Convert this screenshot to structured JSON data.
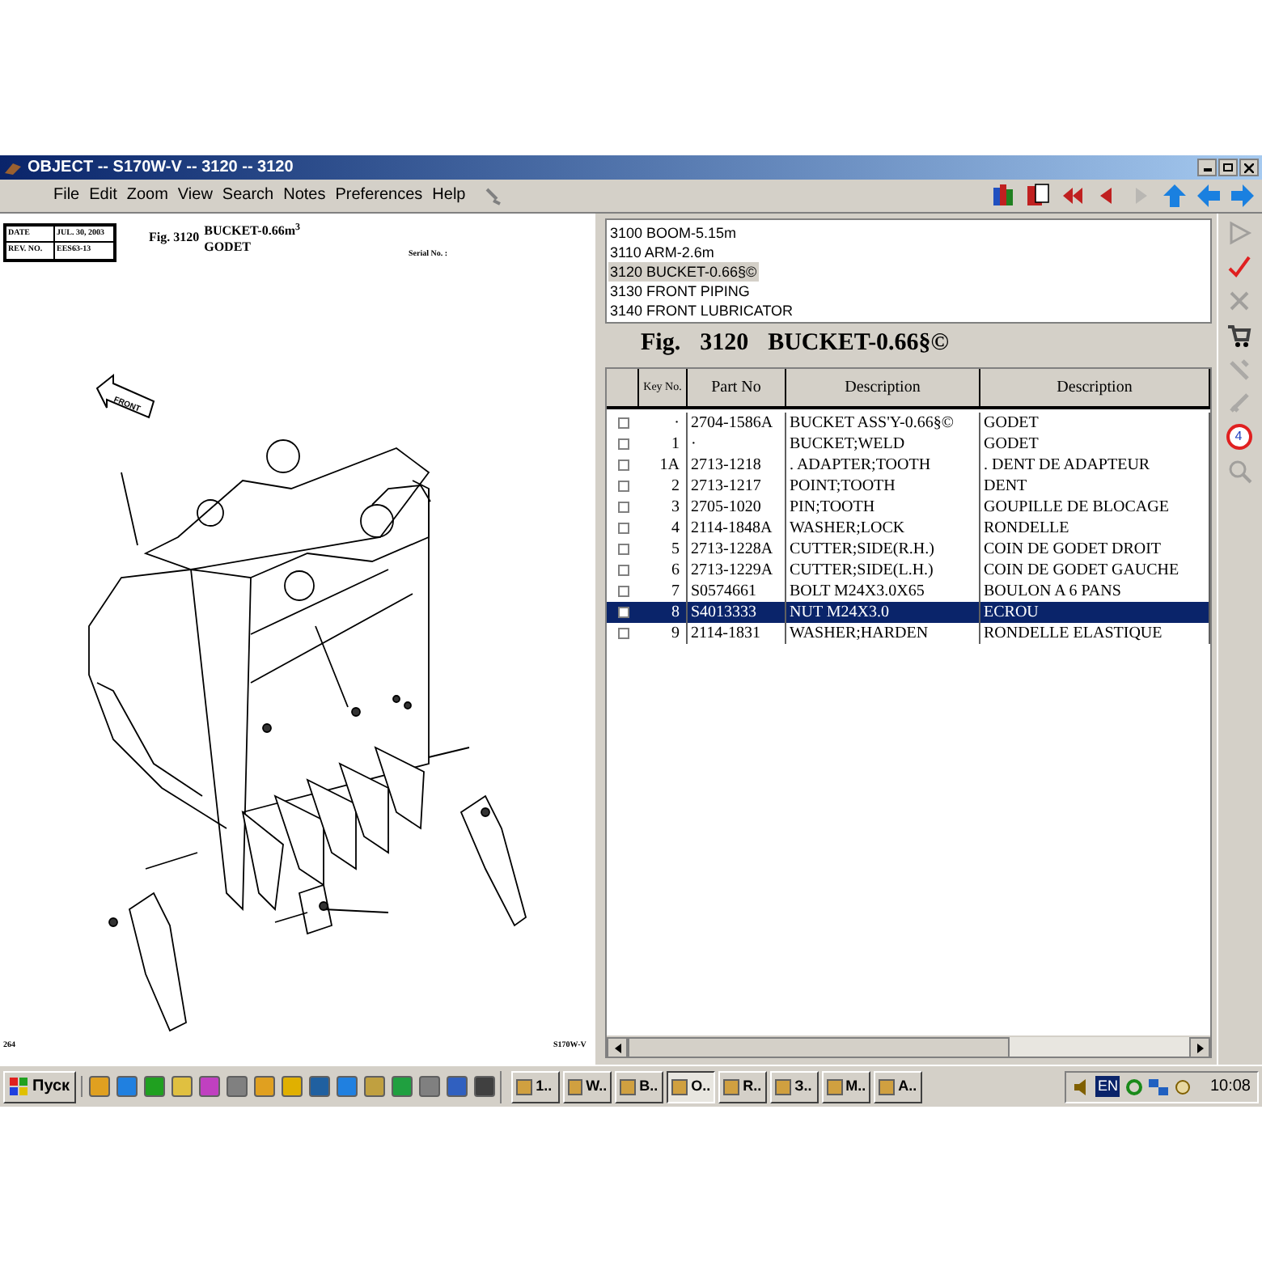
{
  "window": {
    "title": "OBJECT -- S170W-V -- 3120 -- 3120"
  },
  "menu": [
    "File",
    "Edit",
    "Zoom",
    "View",
    "Search",
    "Notes",
    "Preferences",
    "Help"
  ],
  "toolbar": [
    {
      "kind": "books",
      "disabled": false
    },
    {
      "kind": "book-red",
      "disabled": false
    },
    {
      "kind": "first",
      "disabled": false
    },
    {
      "kind": "prev",
      "disabled": false
    },
    {
      "kind": "next",
      "disabled": true
    },
    {
      "kind": "up",
      "disabled": false
    },
    {
      "kind": "back",
      "disabled": false
    },
    {
      "kind": "forward",
      "disabled": false
    }
  ],
  "drawing": {
    "date_label": "DATE",
    "date": "JUL. 30, 2003",
    "rev_label": "REV. NO.",
    "rev": "EES63-13",
    "fig": "Fig. 3120",
    "title": "BUCKET-0.66m$^{3}$",
    "subtitle": "GODET",
    "serial": "Serial No. :",
    "arrow_label": "FRONT",
    "page": "264",
    "model": "S170W-V"
  },
  "sections": [
    {
      "label": "3100 BOOM-5.15m",
      "selected": false
    },
    {
      "label": "3110 ARM-2.6m",
      "selected": false
    },
    {
      "label": "3120 BUCKET-0.66§©",
      "selected": true
    },
    {
      "label": "3130 FRONT PIPING",
      "selected": false
    },
    {
      "label": "3140 FRONT LUBRICATOR",
      "selected": false
    }
  ],
  "figure_title": {
    "fig": "Fig.",
    "number": "3120",
    "name": "BUCKET-0.66§©"
  },
  "table": {
    "columns": [
      "Key No.",
      "Part No",
      "Description",
      "Description"
    ],
    "rows": [
      {
        "checked": false,
        "selected": false,
        "cells": [
          "·",
          "2704-1586A",
          "BUCKET ASS'Y-0.66§©",
          "GODET"
        ]
      },
      {
        "checked": false,
        "selected": false,
        "cells": [
          "1",
          "·",
          "BUCKET;WELD",
          "GODET"
        ]
      },
      {
        "checked": false,
        "selected": false,
        "cells": [
          "1A",
          "2713-1218",
          ". ADAPTER;TOOTH",
          ". DENT DE ADAPTEUR"
        ]
      },
      {
        "checked": false,
        "selected": false,
        "cells": [
          "2",
          "2713-1217",
          "POINT;TOOTH",
          "DENT"
        ]
      },
      {
        "checked": false,
        "selected": false,
        "cells": [
          "3",
          "2705-1020",
          "PIN;TOOTH",
          "GOUPILLE DE BLOCAGE"
        ]
      },
      {
        "checked": false,
        "selected": false,
        "cells": [
          "4",
          "2114-1848A",
          "WASHER;LOCK",
          "RONDELLE"
        ]
      },
      {
        "checked": false,
        "selected": false,
        "cells": [
          "5",
          "2713-1228A",
          "CUTTER;SIDE(R.H.)",
          "COIN DE GODET DROIT"
        ]
      },
      {
        "checked": false,
        "selected": false,
        "cells": [
          "6",
          "2713-1229A",
          "CUTTER;SIDE(L.H.)",
          "COIN DE GODET GAUCHE"
        ]
      },
      {
        "checked": false,
        "selected": false,
        "cells": [
          "7",
          "S0574661",
          "BOLT M24X3.0X65",
          "BOULON A 6 PANS"
        ]
      },
      {
        "checked": false,
        "selected": true,
        "cells": [
          "8",
          "S4013333",
          "NUT M24X3.0",
          "ECROU"
        ]
      },
      {
        "checked": false,
        "selected": false,
        "cells": [
          "9",
          "2114-1831",
          "WASHER;HARDEN",
          "RONDELLE ELASTIQUE"
        ]
      }
    ]
  },
  "side_tools": [
    {
      "kind": "play",
      "disabled": true
    },
    {
      "kind": "check",
      "disabled": false
    },
    {
      "kind": "cross",
      "disabled": true
    },
    {
      "kind": "cart",
      "disabled": false
    },
    {
      "kind": "tool",
      "disabled": true
    },
    {
      "kind": "tool2",
      "disabled": true
    },
    {
      "kind": "badge",
      "disabled": false,
      "badge": "4"
    },
    {
      "kind": "zoom",
      "disabled": true
    }
  ],
  "taskbar": {
    "start": "Пуск",
    "tasks": [
      {
        "label": "1..",
        "selected": false
      },
      {
        "label": "W..",
        "selected": false
      },
      {
        "label": "B..",
        "selected": false
      },
      {
        "label": "O..",
        "selected": true
      },
      {
        "label": "R..",
        "selected": false
      },
      {
        "label": "З..",
        "selected": false
      },
      {
        "label": "M..",
        "selected": false
      },
      {
        "label": "A..",
        "selected": false
      }
    ],
    "language": "EN",
    "clock": "10:08"
  }
}
